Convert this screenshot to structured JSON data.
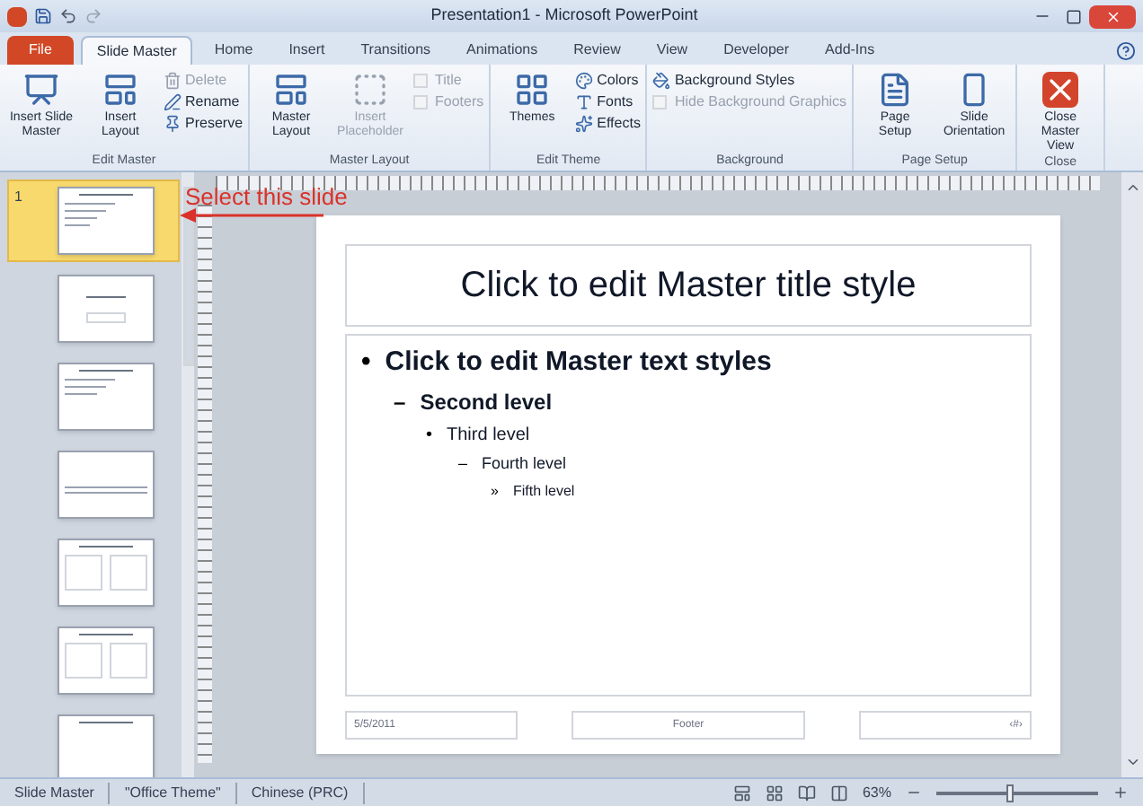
{
  "window": {
    "title": "Presentation1 - Microsoft PowerPoint"
  },
  "ribbon": {
    "tabs": [
      {
        "label": "File",
        "kind": "file",
        "selected": false
      },
      {
        "label": "Slide Master",
        "kind": "tab",
        "selected": true
      },
      {
        "label": "Home",
        "kind": "tab",
        "selected": false
      },
      {
        "label": "Insert",
        "kind": "tab",
        "selected": false
      },
      {
        "label": "Transitions",
        "kind": "tab",
        "selected": false
      },
      {
        "label": "Animations",
        "kind": "tab",
        "selected": false
      },
      {
        "label": "Review",
        "kind": "tab",
        "selected": false
      },
      {
        "label": "View",
        "kind": "tab",
        "selected": false
      },
      {
        "label": "Developer",
        "kind": "tab",
        "selected": false
      },
      {
        "label": "Add-Ins",
        "kind": "tab",
        "selected": false
      }
    ],
    "groups": [
      {
        "label": "Edit Master",
        "columns": [
          [
            {
              "label": "Insert Slide Master",
              "kind": "large",
              "disabled": false
            }
          ],
          [
            {
              "label": "Insert Layout",
              "kind": "large",
              "disabled": false
            }
          ],
          [
            {
              "label": "Delete",
              "kind": "small",
              "disabled": true
            },
            {
              "label": "Rename",
              "kind": "small",
              "disabled": false
            },
            {
              "label": "Preserve",
              "kind": "small",
              "disabled": false
            }
          ]
        ]
      },
      {
        "label": "Master Layout",
        "columns": [
          [
            {
              "label": "Master Layout",
              "kind": "large",
              "disabled": false
            }
          ],
          [
            {
              "label": "Insert Placeholder",
              "kind": "large",
              "disabled": true
            }
          ],
          [
            {
              "label": "Title",
              "kind": "checkbox",
              "disabled": true
            },
            {
              "label": "Footers",
              "kind": "checkbox",
              "disabled": true
            }
          ]
        ]
      },
      {
        "label": "Edit Theme",
        "columns": [
          [
            {
              "label": "Themes",
              "kind": "large",
              "disabled": false
            }
          ],
          [
            {
              "label": "Colors",
              "kind": "small",
              "disabled": false
            },
            {
              "label": "Fonts",
              "kind": "small",
              "disabled": false
            },
            {
              "label": "Effects",
              "kind": "small",
              "disabled": false
            }
          ]
        ]
      },
      {
        "label": "Background",
        "columns": [
          [
            {
              "label": "Background Styles",
              "kind": "small",
              "disabled": false
            },
            {
              "label": "Hide Background Graphics",
              "kind": "checkbox",
              "disabled": true
            }
          ]
        ]
      },
      {
        "label": "Page Setup",
        "columns": [
          [
            {
              "label": "Page Setup",
              "kind": "large",
              "disabled": false
            }
          ],
          [
            {
              "label": "Slide Orientation",
              "kind": "large",
              "disabled": false
            }
          ]
        ]
      },
      {
        "label": "Close",
        "columns": [
          [
            {
              "label": "Close Master View",
              "kind": "large",
              "disabled": false
            }
          ]
        ]
      }
    ]
  },
  "thumbnails": [
    {
      "number": "1",
      "selected": true
    },
    {
      "selected": false
    },
    {
      "selected": false
    },
    {
      "selected": false
    },
    {
      "selected": false
    },
    {
      "selected": false
    },
    {
      "selected": false
    }
  ],
  "annotation": {
    "text": "Select this slide"
  },
  "slide": {
    "title": "Click to edit Master title style",
    "body": [
      {
        "bullet": "•",
        "text": "Click to edit Master text styles",
        "children": [
          {
            "bullet": "–",
            "text": "Second level",
            "children": [
              {
                "bullet": "•",
                "text": "Third level",
                "children": [
                  {
                    "bullet": "–",
                    "text": "Fourth level",
                    "children": [
                      {
                        "bullet": "»",
                        "text": "Fifth level"
                      }
                    ]
                  }
                ]
              }
            ]
          }
        ]
      }
    ],
    "footer": {
      "date": "5/5/2011",
      "center": "Footer",
      "number": "‹#›"
    }
  },
  "status_bar": {
    "items": [
      "Slide Master",
      "\"Office Theme\"",
      "Chinese (PRC)"
    ],
    "zoom": "63%",
    "zoom_slider": {
      "level": 0.45
    }
  }
}
